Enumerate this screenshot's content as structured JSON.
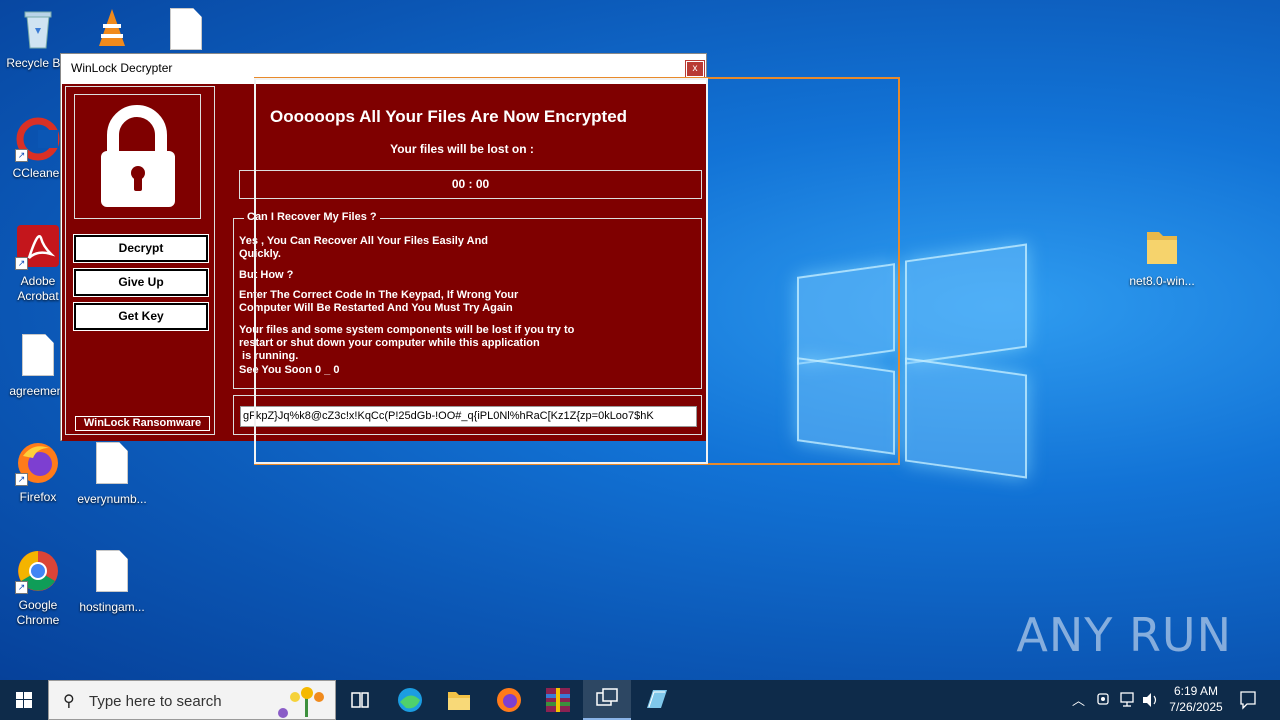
{
  "desktop": {
    "icons_left": [
      {
        "label": "Recycle Bin",
        "icon": "recycle-bin-icon"
      },
      {
        "label": "CCleaner",
        "icon": "ccleaner-icon"
      },
      {
        "label": "Adobe Acrobat",
        "icon": "acrobat-icon"
      },
      {
        "label": "agreement",
        "icon": "document-icon"
      },
      {
        "label": "Firefox",
        "icon": "firefox-icon"
      },
      {
        "label": "Google Chrome",
        "icon": "chrome-icon"
      }
    ],
    "icons_second": [
      {
        "label": "everynumb...",
        "icon": "document-icon"
      },
      {
        "label": "hostingam...",
        "icon": "document-icon"
      }
    ],
    "icon_right": {
      "label": "net8.0-win...",
      "icon": "folder-icon"
    },
    "watermark": "ANY RUN"
  },
  "dialog": {
    "title": "WinLock Decrypter",
    "close_label": "x",
    "headline": "Oooooops All Your Files Are Now Encrypted",
    "lost_on": "Your files will be lost on :",
    "timer": "00 : 00",
    "buttons": {
      "decrypt": "Decrypt",
      "give_up": "Give Up",
      "get_key": "Get Key"
    },
    "brand": "WinLock Ransomware",
    "recover": {
      "legend": "Can I Recover My Files ?",
      "p1": "Yes , You Can Recover All Your Files Easily And\nQuickly.",
      "p2": "But How ?",
      "p3": "Enter The Correct Code In The Keypad, If Wrong Your\nComputer Will Be Restarted And You Must Try Again",
      "p4": "Your files and some system components will be lost if you try to\nrestart or shut down your computer while this application\n is running.",
      "p5": "See You Soon 0 _ 0"
    },
    "code_value": "gFkpZ}Jq%k8@cZ3c!x!KqCc(P!25dGb-!OO#_q{iPL0Nl%hRaC[Kz1Z{zp=0kLoo7$hK"
  },
  "taskbar": {
    "search_placeholder": "Type here to search",
    "time": "6:19 AM",
    "date": "7/26/2025",
    "pinned": [
      "task-view-icon",
      "edge-icon",
      "file-explorer-icon",
      "firefox-icon",
      "winrar-icon",
      "winlock-app-icon",
      "notepad-icon"
    ]
  }
}
